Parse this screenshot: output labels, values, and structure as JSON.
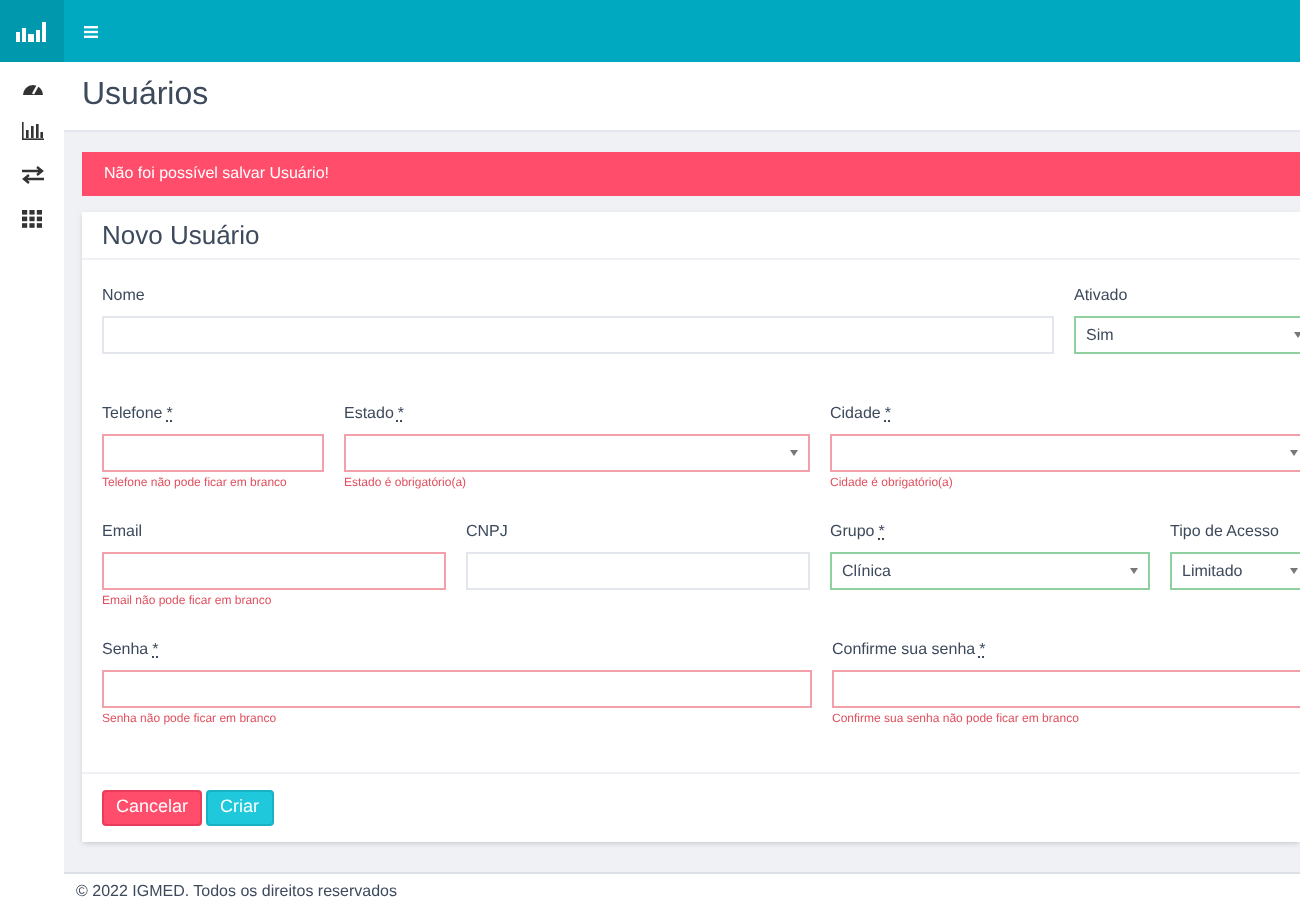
{
  "page_title": "Usuários",
  "alert": "Não foi possível salvar Usuário!",
  "card": {
    "title": "Novo Usuário",
    "form_rows": [
      {
        "fields": [
          {
            "label": "Nome",
            "kind": "text",
            "invalid": false,
            "valid": false
          },
          {
            "label": "Ativado",
            "kind": "select",
            "invalid": false,
            "valid": true,
            "value": "Sim"
          }
        ]
      },
      {
        "fields": [
          {
            "label": "Telefone",
            "required_mark": "*",
            "kind": "text",
            "invalid": true,
            "valid": false,
            "error": "Telefone não pode ficar em branco"
          },
          {
            "label": "Estado",
            "required_mark": "*",
            "kind": "select",
            "invalid": true,
            "valid": false,
            "error": "Estado é obrigatório(a)"
          },
          {
            "label": "Cidade",
            "required_mark": "*",
            "kind": "select",
            "invalid": true,
            "valid": false,
            "error": "Cidade é obrigatório(a)"
          }
        ]
      },
      {
        "fields": [
          {
            "label": "Email",
            "kind": "text",
            "invalid": true,
            "valid": false,
            "error": "Email não pode ficar em branco"
          },
          {
            "label": "CNPJ",
            "kind": "text",
            "invalid": false,
            "valid": false
          },
          {
            "label": "Grupo",
            "required_mark": "*",
            "kind": "select",
            "invalid": false,
            "valid": true,
            "value": "Clínica"
          },
          {
            "label": "Tipo de Acesso",
            "kind": "select",
            "invalid": false,
            "valid": true,
            "value": "Limitado"
          }
        ]
      },
      {
        "fields": [
          {
            "label": "Senha",
            "required_mark": "*",
            "kind": "text",
            "invalid": true,
            "valid": false,
            "error": "Senha não pode ficar em branco"
          },
          {
            "label": "Confirme sua senha",
            "required_mark": "*",
            "kind": "text",
            "invalid": true,
            "valid": false,
            "error": "Confirme sua senha não pode ficar em branco"
          }
        ]
      }
    ],
    "buttons": [
      {
        "label": "Cancelar",
        "kind": "danger"
      },
      {
        "label": "Criar",
        "kind": "primary"
      }
    ]
  },
  "footer": "© 2022 IGMED. Todos os direitos reservados"
}
